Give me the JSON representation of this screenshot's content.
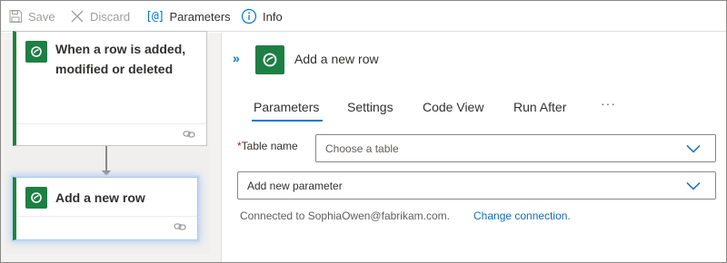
{
  "toolbar": {
    "save_label": "Save",
    "discard_label": "Discard",
    "parameters_label": "Parameters",
    "info_label": "Info",
    "parameters_icon_glyph": "[@]"
  },
  "designer": {
    "trigger_card": {
      "title": "When a row is added, modified or deleted",
      "icon": "dataverse-icon"
    },
    "action_card": {
      "title": "Add a new row",
      "icon": "dataverse-icon",
      "selected": true
    }
  },
  "panel": {
    "collapse_glyph": "»",
    "title": "Add a new row",
    "tabs": [
      {
        "label": "Parameters",
        "active": true
      },
      {
        "label": "Settings",
        "active": false
      },
      {
        "label": "Code View",
        "active": false
      },
      {
        "label": "Run After",
        "active": false
      }
    ],
    "more_glyph": "···",
    "table_name": {
      "required_mark": "*",
      "label": "Table name",
      "placeholder": "Choose a table"
    },
    "add_parameter": {
      "value": "Add new parameter"
    },
    "connection": {
      "text": "Connected to SophiaOwen@fabrikam.com.",
      "change_link": "Change connection."
    }
  },
  "colors": {
    "accent_blue": "#0078d4",
    "connector_green": "#1d7f43",
    "required_red": "#a4262c"
  }
}
